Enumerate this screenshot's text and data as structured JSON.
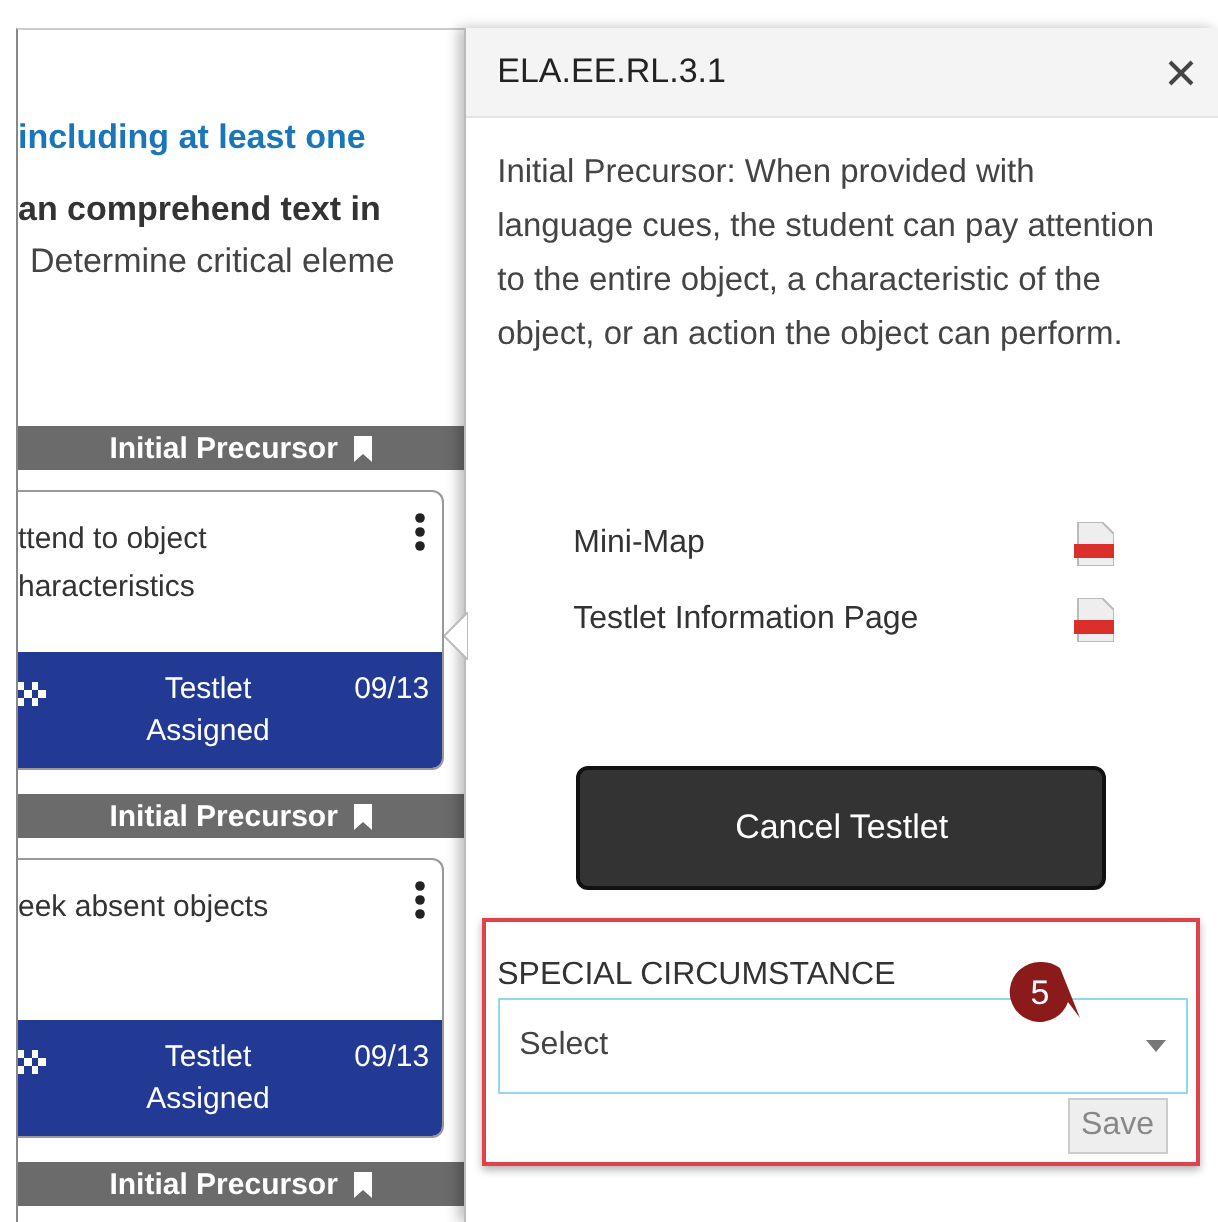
{
  "page": {
    "heading": "including at least one",
    "subheading": "an comprehend text in",
    "line": "Determine critical eleme"
  },
  "cards": [
    {
      "band": "Initial Precursor",
      "lines": [
        "ttend to object",
        "haracteristics"
      ],
      "status": "Testlet Assigned",
      "date": "09/13"
    },
    {
      "band": "Initial Precursor",
      "lines": [
        "eek absent objects"
      ],
      "status": "Testlet Assigned",
      "date": "09/13"
    }
  ],
  "last_band": "Initial Precursor",
  "panel": {
    "title": "ELA.EE.RL.3.1",
    "description": "Initial Precursor: When provided with language cues, the student can pay attention to the entire object, a characteristic of the object, or an action the object can perform.",
    "documents": [
      {
        "label": "Mini-Map"
      },
      {
        "label": "Testlet Information Page"
      }
    ],
    "cancel_button": "Cancel Testlet",
    "special_circumstance": {
      "label": "SPECIAL CIRCUMSTANCE",
      "placeholder": "Select",
      "save_button": "Save",
      "save_disabled": true
    },
    "callout": "5"
  }
}
